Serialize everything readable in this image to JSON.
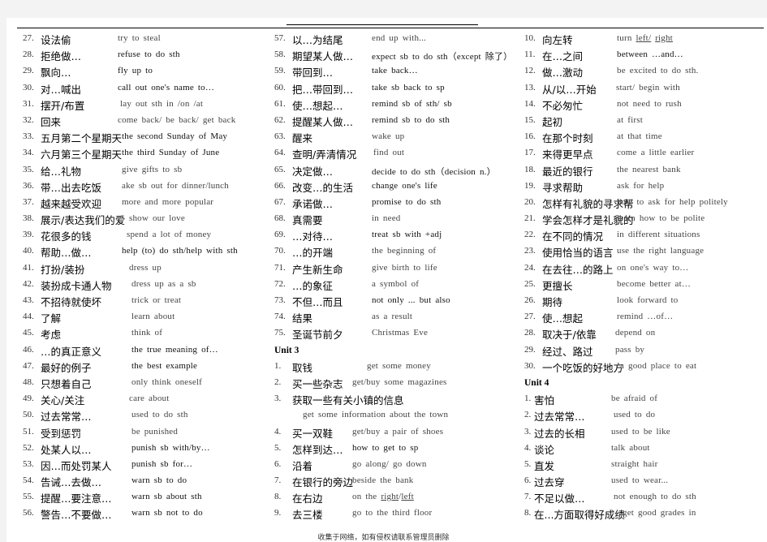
{
  "footer": "收集于网络，如有侵权请联系管理员删除",
  "columns": [
    {
      "blocks": [
        {
          "type": "rows",
          "rows": [
            {
              "num": "27.",
              "cn": "设法偷",
              "en": "try to steal"
            },
            {
              "num": "28.",
              "cn": "拒绝做…",
              "en": "refuse to do sth"
            },
            {
              "num": "29.",
              "cn": "飘向…",
              "en": "fly up to"
            },
            {
              "num": "30.",
              "cn": "对…喊出",
              "en": "call out one's name to…"
            },
            {
              "num": "31.",
              "cn": "摆开/布置",
              "en": "lay out sth in /on /at"
            },
            {
              "num": "32.",
              "cn": "回来",
              "en": "come back/ be back/ get back"
            },
            {
              "num": "33.",
              "cn": "五月第二个星期天",
              "en": "the second Sunday of May"
            },
            {
              "num": "34.",
              "cn": "六月第三个星期天",
              "en": "the third Sunday of June"
            },
            {
              "num": "35.",
              "cn": "给…礼物",
              "en": "give gifts to sb"
            },
            {
              "num": "36.",
              "cn": "带…出去吃饭",
              "en": "ake sb out for dinner/lunch"
            },
            {
              "num": "37.",
              "cn": "越来越受欢迎",
              "en": "more and more popular"
            },
            {
              "num": "38.",
              "cn": "展示/表达我们的爱",
              "en": "show our love"
            },
            {
              "num": "39.",
              "cn": "花很多的钱",
              "en": "spend a lot of money"
            },
            {
              "num": "40.",
              "cn": "帮助…做…",
              "en": "help (to) do sth/help with sth"
            },
            {
              "num": "41.",
              "cn": "打扮/装扮",
              "en": "dress up"
            },
            {
              "num": "42.",
              "cn": "装扮成卡通人物",
              "en": "dress up as a sb"
            },
            {
              "num": "43.",
              "cn": "不招待就使坏",
              "en": "trick or treat"
            },
            {
              "num": "44.",
              "cn": "了解",
              "en": "learn about"
            },
            {
              "num": "45.",
              "cn": "考虑",
              "en": "think of"
            },
            {
              "num": "46.",
              "cn": "…的真正意义",
              "en": "the true meaning of…"
            },
            {
              "num": "47.",
              "cn": "最好的例子",
              "en": "the best example"
            },
            {
              "num": "48.",
              "cn": "只想着自己",
              "en": "only think oneself"
            },
            {
              "num": "49.",
              "cn": "关心/关注",
              "en": "care about"
            },
            {
              "num": "50.",
              "cn": "过去常常…",
              "en": "used to do sth"
            },
            {
              "num": "51.",
              "cn": "受到惩罚",
              "en": "be punished"
            },
            {
              "num": "52.",
              "cn": "处某人以…",
              "en": "punish sb with/by…"
            },
            {
              "num": "53.",
              "cn": "因…而处罚某人",
              "en": "punish sb for…"
            },
            {
              "num": "54.",
              "cn": "告诫…去做…",
              "en": "warn sb to do"
            },
            {
              "num": "55.",
              "cn": "提醒…要注意…",
              "en": "warn sb about sth"
            },
            {
              "num": "56.",
              "cn": "警告…不要做…",
              "en": "warn sb not to do"
            }
          ]
        }
      ]
    },
    {
      "blocks": [
        {
          "type": "rows",
          "rows": [
            {
              "num": "57.",
              "cn": "以…为结尾",
              "en": "end up with..."
            },
            {
              "num": "58.",
              "cn": "期望某人做…",
              "en": "expect sb to do sth（except 除了）"
            },
            {
              "num": "59.",
              "cn": "带回到…",
              "en": "take back…"
            },
            {
              "num": "60.",
              "cn": "把…带回到…",
              "en": "take sb back to sp"
            },
            {
              "num": "61.",
              "cn": "使…想起…",
              "en": "remind sb of sth/ sb"
            },
            {
              "num": "62.",
              "cn": "提醒某人做…",
              "en": "remind sb to do sth"
            },
            {
              "num": "63.",
              "cn": "醒来",
              "en": "wake up"
            },
            {
              "num": "64.",
              "cn": "查明/弄清情况",
              "en": "find out"
            },
            {
              "num": "65.",
              "cn": "决定做…",
              "en": "decide to do sth（decision n.）"
            },
            {
              "num": "66.",
              "cn": "改变…的生活",
              "en": "change one's life"
            },
            {
              "num": "67.",
              "cn": "承诺做…",
              "en": "promise to do sth"
            },
            {
              "num": "68.",
              "cn": "真需要",
              "en": "in need"
            },
            {
              "num": "69.",
              "cn": "…对待…",
              "en": "treat sb with +adj"
            },
            {
              "num": "70.",
              "cn": "…的开端",
              "en": "the beginning of"
            },
            {
              "num": "71.",
              "cn": "产生新生命",
              "en": "give birth to life"
            },
            {
              "num": "72.",
              "cn": "…的象征",
              "en": "a symbol of"
            },
            {
              "num": "73.",
              "cn": "不但…而且",
              "en": "not only ... but also"
            },
            {
              "num": "74.",
              "cn": "结果",
              "en": "as a result"
            },
            {
              "num": "75.",
              "cn": "圣诞节前夕",
              "en": "Christmas Eve"
            }
          ]
        },
        {
          "type": "unit",
          "label": "Unit 3"
        },
        {
          "type": "rows",
          "rows": [
            {
              "num": "1.",
              "cn": "取钱",
              "en": "get some money"
            },
            {
              "num": "2.",
              "cn": "买一些杂志",
              "en": "get/buy some magazines"
            },
            {
              "num": "3.",
              "cn": "获取一些有关小镇的信息",
              "en": ""
            },
            {
              "num": "",
              "cn": "",
              "en": "get some information about the town"
            },
            {
              "num": "4.",
              "cn": "买一双鞋",
              "en": "get/buy a pair of shoes"
            },
            {
              "num": "5.",
              "cn": "怎样到达…",
              "en": "how to get to sp"
            },
            {
              "num": "6.",
              "cn": "沿着",
              "en": "go along/ go down"
            },
            {
              "num": "7.",
              "cn": "在银行的旁边",
              "en": "beside the bank"
            },
            {
              "num": "8.",
              "cn": "在右边",
              "en": "on the right/left"
            },
            {
              "num": "9.",
              "cn": "去三楼",
              "en": "go to the third floor"
            }
          ]
        }
      ]
    },
    {
      "blocks": [
        {
          "type": "rows",
          "rows": [
            {
              "num": "10.",
              "cn": "向左转",
              "en": "turn left/ right"
            },
            {
              "num": "11.",
              "cn": "在…之间",
              "en": "between …and…"
            },
            {
              "num": "12.",
              "cn": "做…激动",
              "en": "be excited to do sth."
            },
            {
              "num": "13.",
              "cn": "从/以…开始",
              "en": "start/ begin with"
            },
            {
              "num": "14.",
              "cn": "不必匆忙",
              "en": "not need to rush"
            },
            {
              "num": "15.",
              "cn": "起初",
              "en": "at first"
            },
            {
              "num": "16.",
              "cn": "在那个时刻",
              "en": "at that time"
            },
            {
              "num": "17.",
              "cn": "来得更早点",
              "en": "come a little earlier"
            },
            {
              "num": "18.",
              "cn": "最近的银行",
              "en": "the nearest bank"
            },
            {
              "num": "19.",
              "cn": "寻求帮助",
              "en": "ask for help"
            },
            {
              "num": "20.",
              "cn": "怎样有礼貌的寻求帮",
              "en": "how to ask for help politely"
            },
            {
              "num": "21.",
              "cn": "学会怎样才是礼貌的",
              "en": "learn how to be polite"
            },
            {
              "num": "22.",
              "cn": "在不同的情况",
              "en": "in different situations"
            },
            {
              "num": "23.",
              "cn": "使用恰当的语言",
              "en": "use the right language"
            },
            {
              "num": "24.",
              "cn": "在去往…的路上",
              "en": "on one's way to…"
            },
            {
              "num": "25.",
              "cn": "更擅长",
              "en": "become better at…"
            },
            {
              "num": "26.",
              "cn": "期待",
              "en": "look forward to"
            },
            {
              "num": "27.",
              "cn": "使…想起",
              "en": "remind …of…"
            },
            {
              "num": "28.",
              "cn": "取决于/依靠",
              "en": "depend on"
            },
            {
              "num": "29.",
              "cn": "经过、路过",
              "en": "pass by"
            },
            {
              "num": "30.",
              "cn": "一个吃饭的好地方",
              "en": "a good place to eat"
            }
          ]
        },
        {
          "type": "unit",
          "label": "Unit 4"
        },
        {
          "type": "rows",
          "rows": [
            {
              "num": "1.",
              "cn": "害怕",
              "en": "be afraid of"
            },
            {
              "num": "2.",
              "cn": "过去常常…",
              "en": "used to do"
            },
            {
              "num": "3.",
              "cn": "过去的长相",
              "en": "used to be like"
            },
            {
              "num": "4.",
              "cn": "谈论",
              "en": "talk about"
            },
            {
              "num": "5.",
              "cn": "直发",
              "en": "straight hair"
            },
            {
              "num": "6.",
              "cn": "过去穿",
              "en": "used to wear..."
            },
            {
              "num": "7.",
              "cn": "不足以做…",
              "en": "not enough to do sth"
            },
            {
              "num": "8.",
              "cn": "在...方面取得好成绩",
              "en": "get good grades in"
            }
          ]
        }
      ]
    }
  ]
}
